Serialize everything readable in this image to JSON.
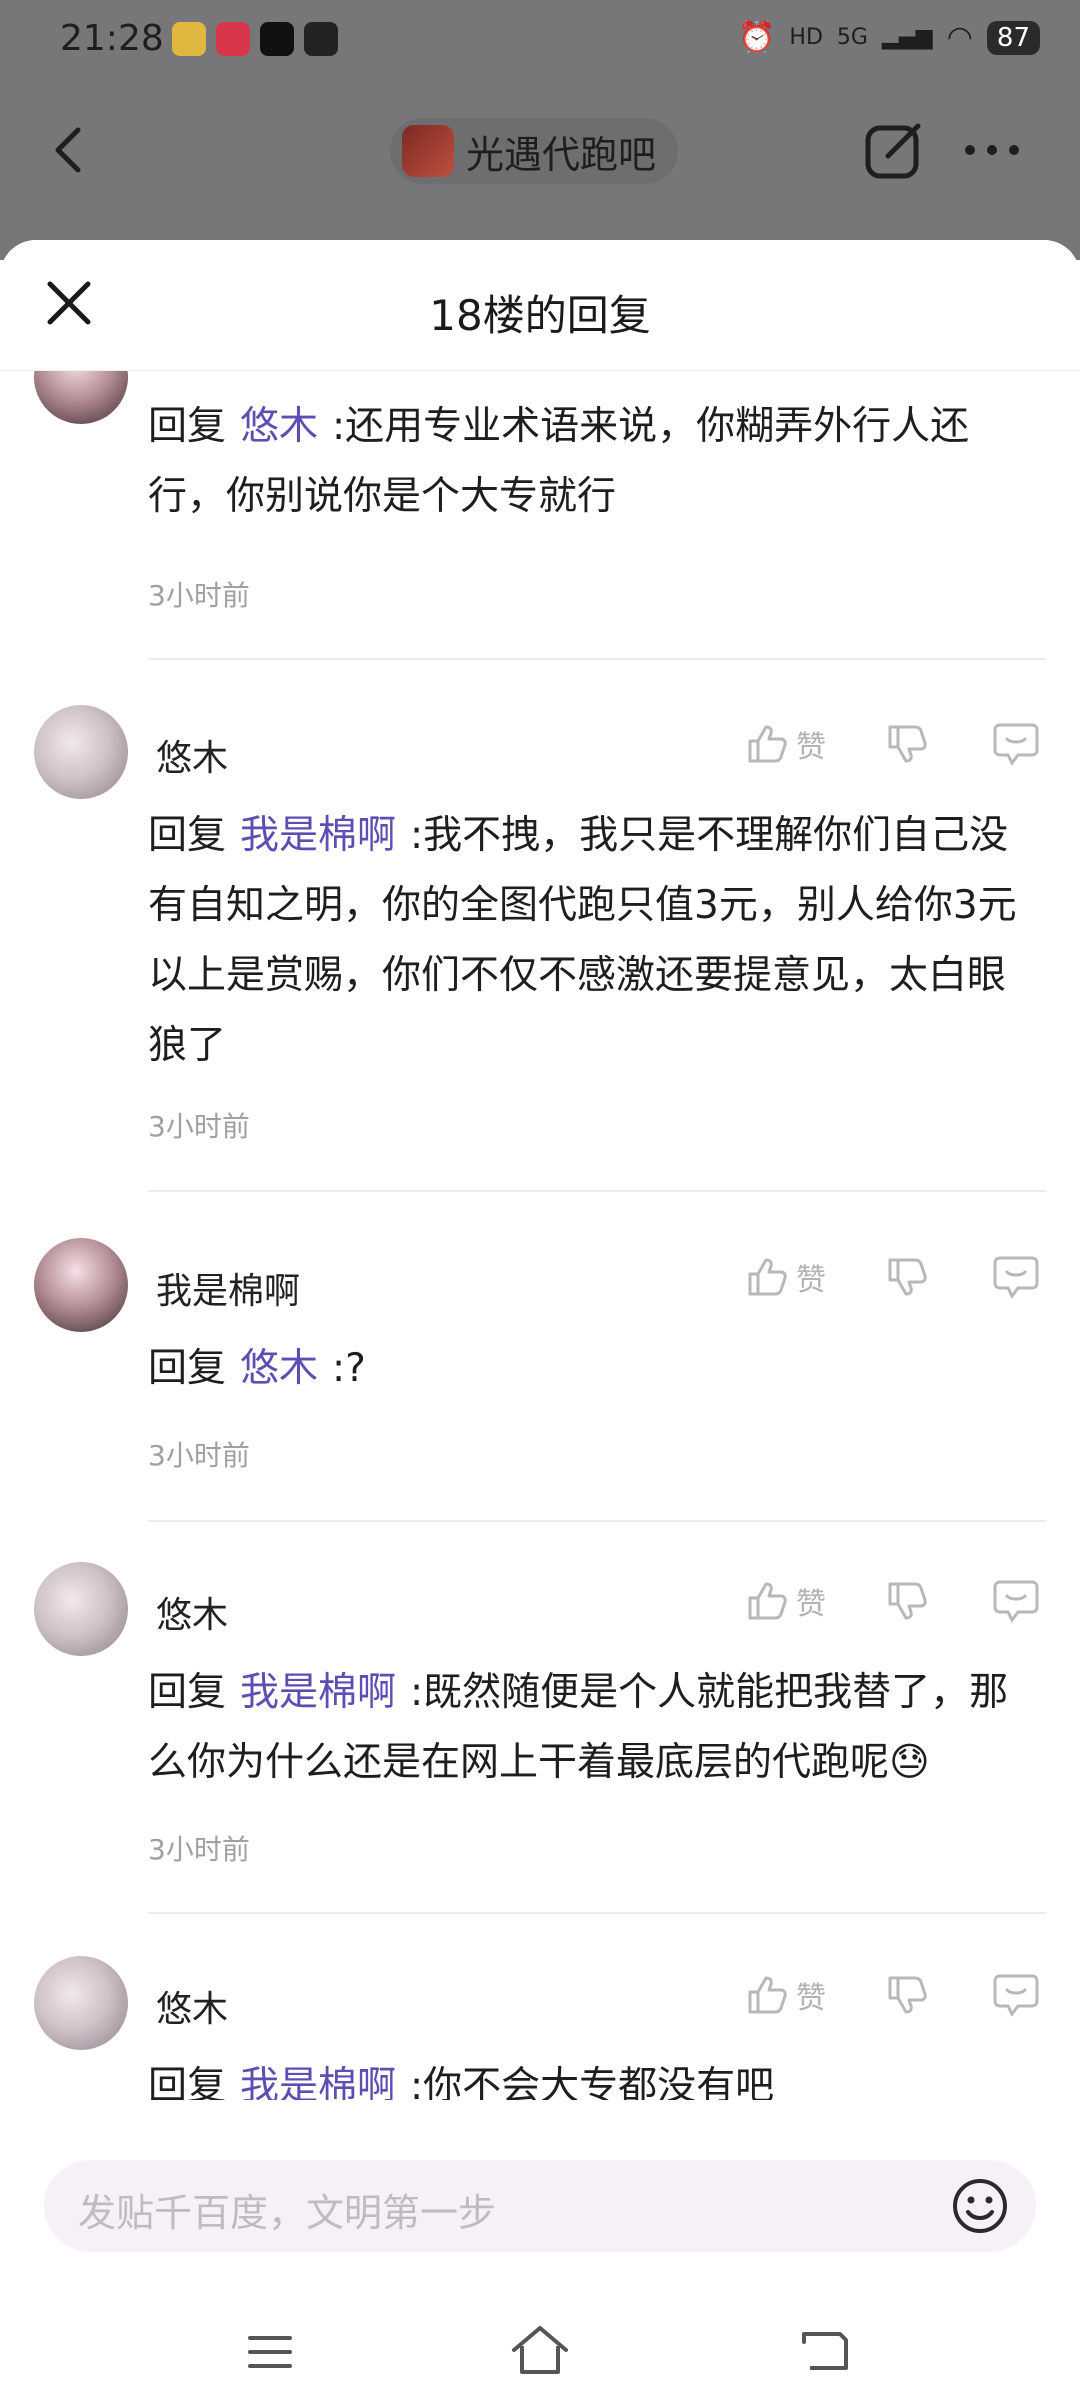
{
  "status_bar": {
    "time": "21:28",
    "network": "5G",
    "battery": "87"
  },
  "top_nav": {
    "forum_name": "光遇代跑吧"
  },
  "sheet": {
    "title": "18楼的回复"
  },
  "replies": [
    {
      "prefix": "回复",
      "mention": "悠木",
      "text": ":还用专业术语来说，你糊弄外行人还行，你别说你是个大专就行",
      "time": "3小时前"
    },
    {
      "username": "悠木",
      "like_label": "赞",
      "prefix": "回复",
      "mention": "我是棉啊",
      "text": ":我不拽，我只是不理解你们自己没有自知之明，你的全图代跑只值3元，别人给你3元以上是赏赐，你们不仅不感激还要提意见，太白眼狼了",
      "time": "3小时前"
    },
    {
      "username": "我是棉啊",
      "like_label": "赞",
      "prefix": "回复",
      "mention": "悠木",
      "text": ":?",
      "time": "3小时前"
    },
    {
      "username": "悠木",
      "like_label": "赞",
      "prefix": "回复",
      "mention": "我是棉啊",
      "text": ":既然随便是个人就能把我替了，那么你为什么还是在网上干着最底层的代跑呢",
      "emoji": "😓",
      "time": "3小时前"
    },
    {
      "username": "悠木",
      "like_label": "赞",
      "prefix": "回复",
      "mention": "我是棉啊",
      "text": ":你不会大专都没有吧"
    }
  ],
  "input": {
    "placeholder": "发贴千百度，文明第一步"
  },
  "colors": {
    "mention": "#5b4fb3",
    "time": "#a0a0a0"
  },
  "icons": [
    "back-arrow-icon",
    "share-icon",
    "more-icon",
    "close-icon",
    "thumbs-up-icon",
    "thumbs-down-icon",
    "comment-icon",
    "emoji-icon",
    "menu-icon",
    "home-icon",
    "back-icon"
  ]
}
